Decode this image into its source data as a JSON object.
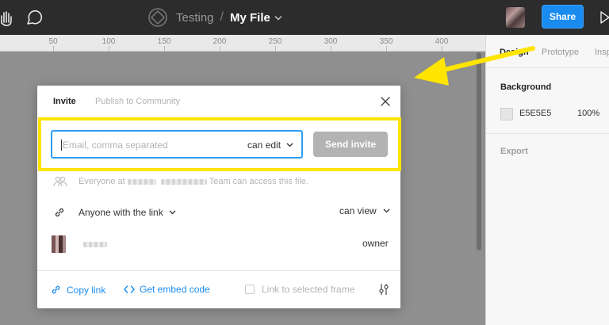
{
  "topbar": {
    "project": "Testing",
    "separator": "/",
    "file_name": "My File",
    "share_label": "Share",
    "icons": [
      "hand-icon",
      "comment-icon",
      "component-icon",
      "chevron-down-icon",
      "play-icon"
    ]
  },
  "ruler": {
    "ticks": [
      "50",
      "100",
      "150",
      "200",
      "250",
      "300",
      "350",
      "400"
    ]
  },
  "right_panel": {
    "tabs": [
      "Design",
      "Prototype",
      "Insp"
    ],
    "background_label": "Background",
    "bg_hex": "E5E5E5",
    "bg_opacity": "100%",
    "export_label": "Export"
  },
  "modal": {
    "tabs": {
      "invite": "Invite",
      "publish": "Publish to Community"
    },
    "email_placeholder": "Email, comma separated",
    "permission": "can edit",
    "send_label": "Send invite",
    "team_access": {
      "prefix": "Everyone at",
      "suffix": "Team can access this file."
    },
    "link_access": {
      "label": "Anyone with the link",
      "permission": "can view"
    },
    "owner_role": "owner",
    "footer": {
      "copy_link": "Copy link",
      "embed": "Get embed code",
      "frame_link": "Link to selected frame"
    }
  },
  "colors": {
    "accent": "#1a8cf0",
    "highlight": "#ffe500",
    "arrow": "#ffe500",
    "topbar": "#2c2c2c"
  }
}
